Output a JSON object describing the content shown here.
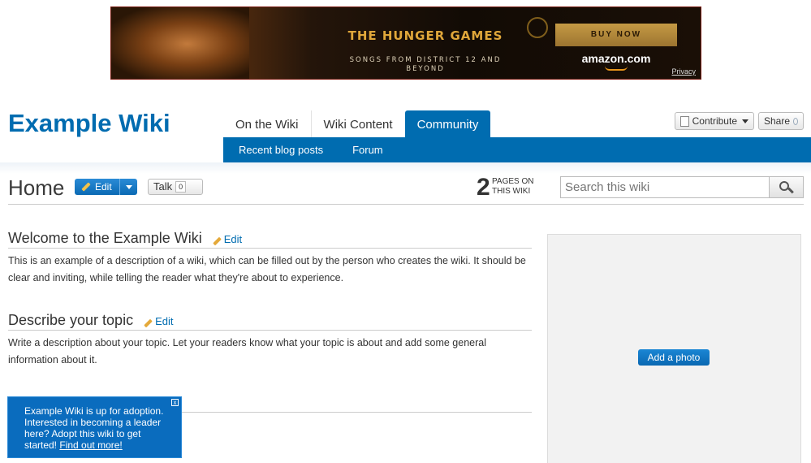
{
  "ad": {
    "title": "THE HUNGER GAMES",
    "subtitle": "SONGS FROM DISTRICT 12 AND BEYOND",
    "cta": "BUY NOW",
    "brand": "amazon.com",
    "privacy": "Privacy"
  },
  "wiki": {
    "title": "Example Wiki"
  },
  "nav": {
    "tabs": [
      "On the Wiki",
      "Wiki Content",
      "Community"
    ],
    "active_tab": "Community",
    "subnav": [
      "Recent blog posts",
      "Forum"
    ]
  },
  "actions": {
    "contribute": "Contribute",
    "share": "Share"
  },
  "page": {
    "title": "Home",
    "edit_label": "Edit",
    "talk_label": "Talk",
    "talk_count": "0",
    "pages_count": "2",
    "pages_label_1": "PAGES ON",
    "pages_label_2": "THIS WIKI"
  },
  "search": {
    "placeholder": "Search this wiki"
  },
  "sections": [
    {
      "heading": "Welcome to the Example Wiki",
      "edit": "Edit",
      "body": "This is an example of a description of a wiki, which can be filled out by the person who creates the wiki. It should be clear and inviting, while telling the reader what they're about to experience."
    },
    {
      "heading": "Describe your topic",
      "edit": "Edit",
      "body": "Write a description about your topic. Let your readers know what your topic is about and add some general information about it."
    }
  ],
  "rail": {
    "add_photo": "Add a photo"
  },
  "adoption": {
    "text": "Example Wiki is up for adoption. Interested in becoming a leader here? Adopt this wiki to get started!",
    "link": "Find out more!",
    "close": "x"
  },
  "colors": {
    "brand_blue": "#006cb0"
  }
}
